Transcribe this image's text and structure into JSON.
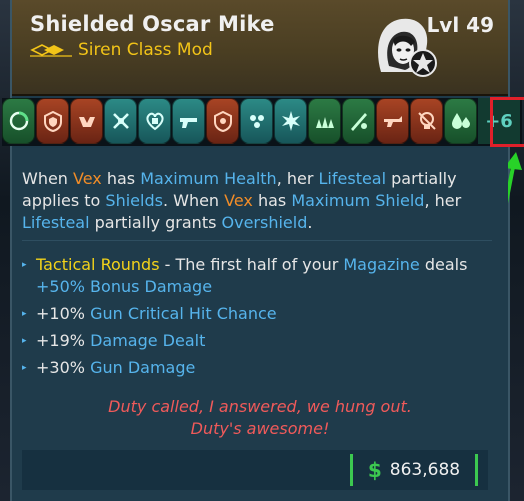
{
  "item": {
    "name": "Shielded Oscar Mike",
    "class": "Siren Class Mod",
    "level": "Lvl 49",
    "portrait_icon": "vex-portrait-icon",
    "badge_icon": "pet-badge-icon"
  },
  "perks": {
    "icons": [
      {
        "name": "perk-green-swirl-icon",
        "tone": "green"
      },
      {
        "name": "perk-red-shield-icon",
        "tone": "red"
      },
      {
        "name": "perk-red-hands-icon",
        "tone": "red"
      },
      {
        "name": "perk-teal-crossed-icon",
        "tone": "teal"
      },
      {
        "name": "perk-teal-heart-icon",
        "tone": "teal"
      },
      {
        "name": "perk-teal-gun-icon",
        "tone": "teal"
      },
      {
        "name": "perk-red-emblem-icon",
        "tone": "red"
      },
      {
        "name": "perk-teal-orbs-icon",
        "tone": "teal"
      },
      {
        "name": "perk-teal-burst-icon",
        "tone": "teal"
      },
      {
        "name": "perk-green-grass-icon",
        "tone": "green"
      },
      {
        "name": "perk-green-blade-icon",
        "tone": "green"
      },
      {
        "name": "perk-red-rifle-icon",
        "tone": "red"
      },
      {
        "name": "perk-red-skull-icon",
        "tone": "red"
      },
      {
        "name": "perk-green-drops-icon",
        "tone": "green"
      }
    ],
    "more_label": "+6"
  },
  "description": {
    "p1": "When ",
    "vex1": "Vex",
    "p2": " has ",
    "maxhealth": "Maximum Health",
    "p3": ", her ",
    "lifesteal1": "Lifesteal",
    "p4": " partially applies to ",
    "shields": "Shields",
    "p5": ". When ",
    "vex2": "Vex",
    "p6": " has ",
    "maxshield": "Maximum Shield",
    "p7": ", her ",
    "lifesteal2": "Lifesteal",
    "p8": " partially grants ",
    "overshield": "Overshield",
    "p9": "."
  },
  "bullets": {
    "tactical_name": "Tactical Rounds",
    "tactical_mid": " - The first half of your ",
    "magazine": "Magazine",
    "tactical_deals": " deals ",
    "bonus": "+50% Bonus Damage",
    "b2_value": "+10% ",
    "b2_stat": "Gun Critical Hit Chance",
    "b3_value": "+19% ",
    "b3_stat": "Damage Dealt",
    "b4_value": "+30% ",
    "b4_stat": "Gun Damage"
  },
  "flavor": {
    "line1": "Duty called, I answered, we hung out.",
    "line2": "Duty's awesome!"
  },
  "price": {
    "currency": "$",
    "value": "863,688"
  },
  "colors": {
    "accent_orange": "#f08c28",
    "accent_blue": "#56b4ec",
    "accent_yellow": "#f2d21a",
    "flavor_red": "#f05a5a",
    "money_green": "#3cc850",
    "annotation_red": "#e0202a",
    "annotation_green": "#28d228"
  }
}
